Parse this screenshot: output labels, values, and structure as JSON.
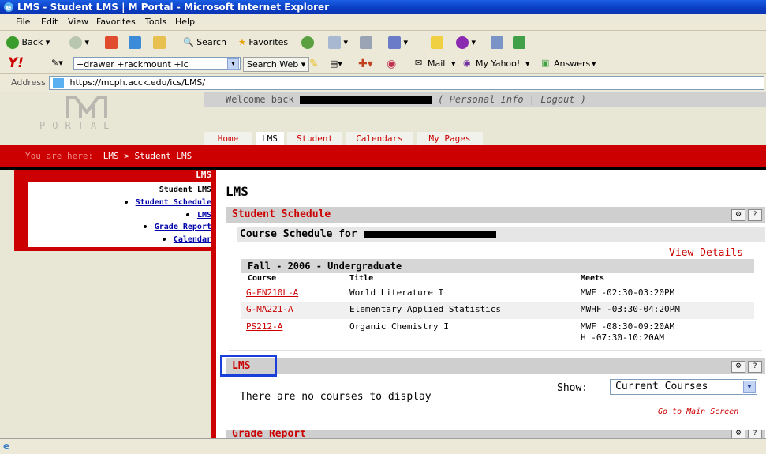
{
  "window": {
    "title": "LMS - Student LMS | M Portal - Microsoft Internet Explorer"
  },
  "menu": {
    "items": [
      "File",
      "Edit",
      "View",
      "Favorites",
      "Tools",
      "Help"
    ]
  },
  "toolbar": {
    "back_label": "Back",
    "search_label": "Search",
    "favorites_label": "Favorites"
  },
  "yahoo": {
    "logo_text": "Y!",
    "search_value": "+drawer +rackmount +lc",
    "search_web_label": "Search Web",
    "mail_label": "Mail",
    "my_yahoo_label": "My Yahoo!",
    "answers_label": "Answers"
  },
  "address": {
    "label": "Address",
    "url": "https://mcph.acck.edu/ics/LMS/"
  },
  "portal": {
    "logo_word": "PORTAL",
    "welcome_prefix": "Welcome back",
    "welcome_links": "( Personal Info | Logout )",
    "tabs": [
      "Home",
      "LMS",
      "Student",
      "Calendars",
      "My Pages"
    ],
    "active_tab": "LMS",
    "breadcrumb_prefix": "You are here:",
    "breadcrumb_path": "LMS > Student LMS"
  },
  "leftnav": {
    "header": "LMS",
    "items": [
      {
        "label": "Student LMS"
      },
      {
        "label": "Student Schedule"
      },
      {
        "label": "LMS"
      },
      {
        "label": "Grade Report"
      },
      {
        "label": "Calendar"
      }
    ]
  },
  "main": {
    "page_title": "LMS",
    "schedule": {
      "title": "Student Schedule",
      "subtitle": "Course Schedule for",
      "view_details": "View Details",
      "term": "Fall - 2006 - Undergraduate",
      "columns": [
        "Course",
        "Title",
        "Meets"
      ],
      "rows": [
        {
          "course": "G-EN210L-A",
          "title": "World Literature I",
          "meets": [
            "MWF -02:30-03:20PM"
          ]
        },
        {
          "course": "G-MA221-A",
          "title": "Elementary Applied Statistics",
          "meets": [
            "MWHF -03:30-04:20PM"
          ]
        },
        {
          "course": "PS212-A",
          "title": "Organic Chemistry I",
          "meets": [
            "MWF -08:30-09:20AM",
            "H -07:30-10:20AM"
          ]
        }
      ]
    },
    "lms": {
      "title": "LMS",
      "empty_message": "There are no courses to display",
      "show_label": "Show:",
      "show_value": "Current Courses",
      "go_main": "Go to Main Screen"
    },
    "grade": {
      "title": "Grade Report"
    },
    "icons": {
      "settings": "?"
    }
  },
  "colors": {
    "accent_red": "#cc0000",
    "ie_blue": "#0a3cc0",
    "highlight_blue": "#1a3fd8"
  }
}
